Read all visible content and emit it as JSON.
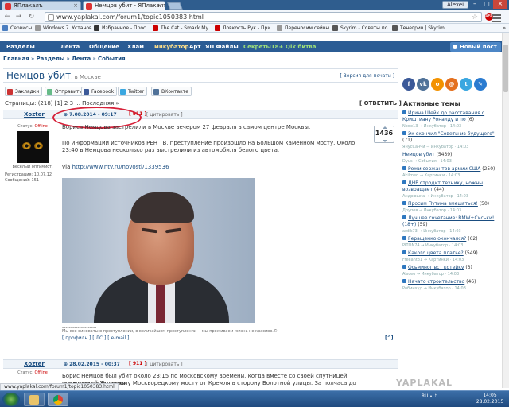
{
  "browser": {
    "tabs": [
      {
        "title": "ЯПлакалъ",
        "active": false
      },
      {
        "title": "Немцов убит - ЯПлакалъ",
        "active": true
      }
    ],
    "user_button": "Alexei",
    "url": "www.yaplakal.com/forum1/topic1050383.html",
    "bookmarks": [
      "Сервисы",
      "Windows 7. Установ...",
      "Избранное - Прос...",
      "The Cat - Smack My...",
      "Ловкость Рук - При...",
      "Переносим сейвы ...",
      "Skyrim - Советы по ...",
      "Тенегрив | Skyrim"
    ],
    "bookmarks_other": "»",
    "status_url": "www.yaplakal.com/forum1/topic1050383.html"
  },
  "site": {
    "nav": [
      "Разделы",
      "Лента",
      "Общение",
      "Хлам",
      "Инкубатор",
      "Арт",
      "ЯП Файлы",
      "Секреты18+",
      "Qik битва"
    ],
    "new_post": "Новый пост",
    "breadcrumbs": [
      "Главная",
      "Разделы",
      "Лента",
      "События"
    ],
    "topic_title": "Немцов убит",
    "topic_place": ", в Москве",
    "print_link": "[ Версия для печати ]",
    "share": [
      "Закладки",
      "Отправить",
      "Facebook",
      "Twitter",
      "ВКонтакте"
    ],
    "pages": "Страницы: (218) [1] 2 3 ... Последняя »",
    "reply": "[ ОТВЕТИТЬ ]",
    "post1": {
      "author": "Xozter",
      "status": "Статус:",
      "status_value": "Offline",
      "motto": "Весёлый оптимист.",
      "reg": "Регистрация: 10.07.12",
      "msgs": "Сообщений: 151",
      "date": "7.08.2014 - 09:17",
      "num": "[ 911 ]",
      "cite": "[ цитировать ]",
      "rating": "1436",
      "p1": "Бориса Немцова застрелили в Москве вечером 27 февраля в самом центре Москвы.",
      "p2": "По информации источников РЕН ТВ, преступление произошло на Большом каменном мосту. Около 23:40 в Немцова несколько раз выстрелили из автомобиля белого цвета.",
      "via": "via",
      "link": "http://www.ntv.ru/novosti/1339536",
      "sig_line": "--------------------",
      "sig": "Мы все виноваты в преступлении, в величайшем преступлении -- мы проживаем жизнь не красиво.©",
      "links": "[ профиль ] [ ЛС ] [ e-mail ]",
      "to_top": "[^]"
    },
    "post2": {
      "author": "Xozter",
      "status": "Статус:",
      "status_value": "Offline",
      "date": "28.02.2015 - 00:37",
      "num": "[ 911 ]",
      "cite": "[ цитировать ]",
      "p1": "Борис Немцов был убит около 23:15 по московскому времени, когда вместе со своей спутницей, гражданкой Украины",
      "p2": "проходил по Большому Москворецкому мосту от Кремля в сторону Болотной улицы. За полчаса до этого у..."
    },
    "sidebar": {
      "title": "Активные темы",
      "topics": [
        {
          "t": "Ирина Шейк до расставания с Криштиану Роналду и по",
          "c": "(6)",
          "m": "Node13 → Инкубатор · 14:03"
        },
        {
          "t": "Эк окончил \"Советы из будущего\"",
          "c": "(71)",
          "m": "ЯнусСанчи → Инкубатор · 14:03"
        },
        {
          "t": "Немцов убит",
          "c": "(5439)",
          "m": "Dyus → События · 14:03"
        },
        {
          "t": "Рожи сержантов армии США",
          "c": "(250)",
          "m": "Akilmed → Картинки · 14:03"
        },
        {
          "t": "ДНР отродит технику, ножны возвращает",
          "c": "(44)",
          "m": "Андрюшка → Инкубатор · 14:03"
        },
        {
          "t": "Просим Путина вмешаться!",
          "c": "(50)",
          "m": "Друпов → Инкубатор · 14:03"
        },
        {
          "t": "Лучшее сочетание: BMW+Сиськи! (18+)",
          "c": "(59)",
          "m": "ardik73 → Инкубатор · 14:03"
        },
        {
          "t": "Геращенко окончался?",
          "c": "(62)",
          "m": "PITON74 → Инкубатор · 14:03"
        },
        {
          "t": "Какого цвета платье?",
          "c": "(549)",
          "m": "Freeant81 → Картинки · 14:03"
        },
        {
          "t": "Осьминог вст котейку",
          "c": "(3)",
          "m": "Alsceo → Инкубатор · 14:03"
        },
        {
          "t": "Начато строительство",
          "c": "(46)",
          "m": "Робинхуд → Инкубатор · 14:03"
        }
      ]
    }
  },
  "taskbar": {
    "lang": "RU",
    "time": "14:05",
    "date": "28.02.2015"
  },
  "watermark": "YAPLAKAL"
}
